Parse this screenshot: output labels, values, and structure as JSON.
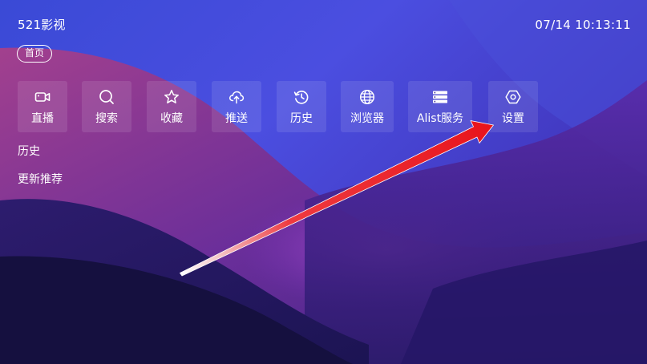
{
  "app": {
    "title": "521影视"
  },
  "clock": "07/14 10:13:11",
  "tabs": [
    {
      "label": "首页"
    }
  ],
  "nav": {
    "items": [
      {
        "label": "直播",
        "icon": "video-camera-icon"
      },
      {
        "label": "搜索",
        "icon": "search-icon"
      },
      {
        "label": "收藏",
        "icon": "star-icon"
      },
      {
        "label": "推送",
        "icon": "cloud-upload-icon"
      },
      {
        "label": "历史",
        "icon": "history-clock-icon"
      },
      {
        "label": "浏览器",
        "icon": "globe-icon"
      },
      {
        "label": "Alist服务",
        "icon": "server-list-icon"
      },
      {
        "label": "设置",
        "icon": "settings-hexagon-icon"
      }
    ]
  },
  "sections": {
    "history": "历史",
    "updates": "更新推荐"
  },
  "colors": {
    "arrow": "#e8141c",
    "tile_bg": "rgba(255,255,255,0.10)",
    "text": "#ffffff"
  }
}
